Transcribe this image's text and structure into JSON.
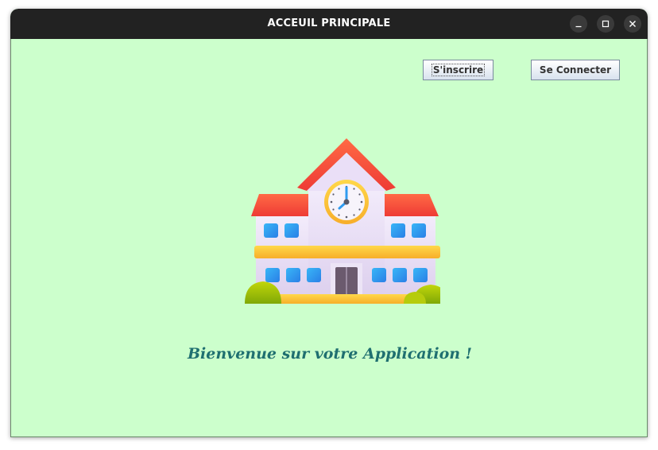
{
  "window": {
    "title": "ACCEUIL PRINCIPALE",
    "controls": [
      "minimize-icon",
      "maximize-icon",
      "close-icon"
    ]
  },
  "toolbar": {
    "register_label": "S'inscrire",
    "login_label": "Se Connecter"
  },
  "main": {
    "illustration": "school-building-icon",
    "welcome_text": "Bienvenue sur votre Application !"
  },
  "colors": {
    "background": "#ccffcc",
    "titlebar": "#222222",
    "welcome_text": "#1f6f70",
    "roof": "#f4523b",
    "window_glass": "#2f9bf0",
    "clock_ring": "#f7b731"
  }
}
